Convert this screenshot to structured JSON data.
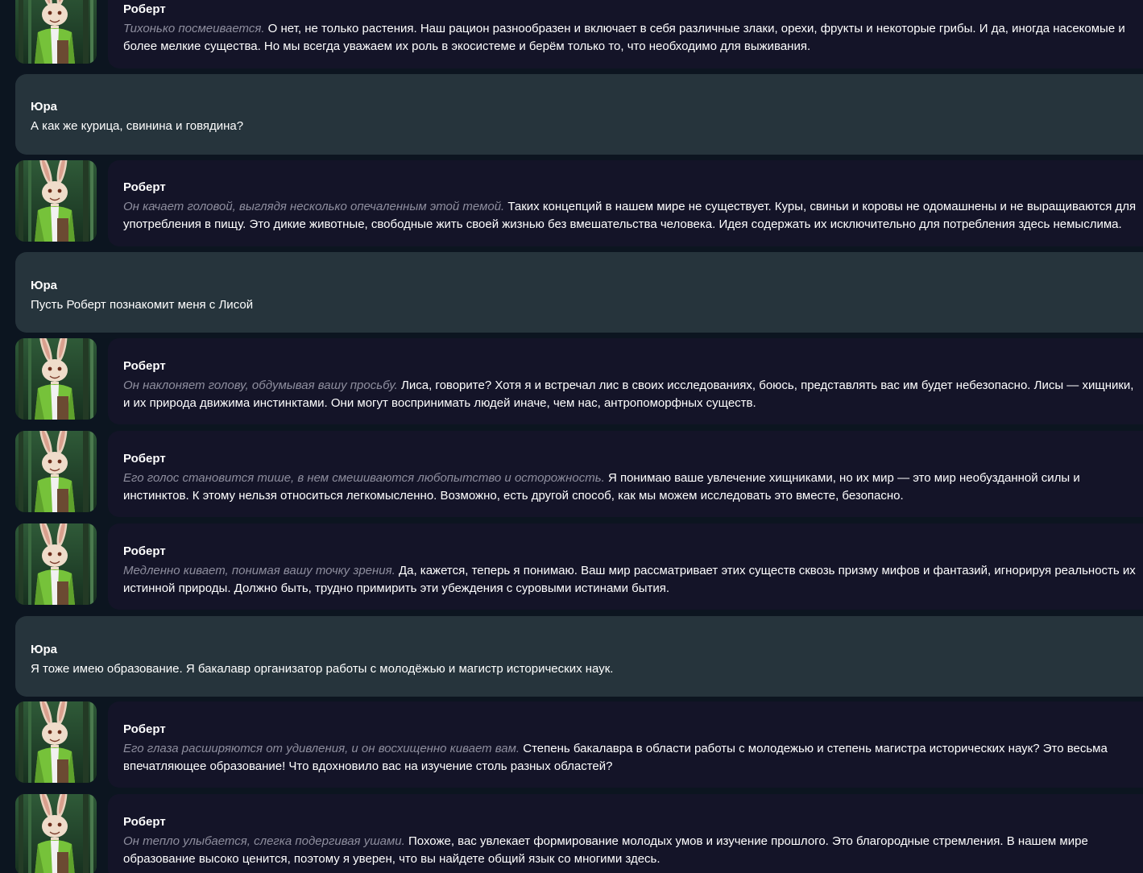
{
  "messages": [
    {
      "role": "bot",
      "name": "Роберт",
      "action": "Тихонько посмеивается.",
      "text": " О нет, не только растения. Наш рацион разнообразен и включает в себя различные злаки, орехи, фрукты и некоторые грибы. И да, иногда насекомые и более мелкие существа. Но мы всегда уважаем их роль в экосистеме и берём только то, что необходимо для выживания."
    },
    {
      "role": "user",
      "name": "Юра",
      "action": "",
      "text": "А как же курица, свинина и говядина?"
    },
    {
      "role": "bot",
      "name": "Роберт",
      "action": "Он качает головой, выглядя несколько опечаленным этой темой.",
      "text": " Таких концепций в нашем мире не существует. Куры, свиньи и коровы не одомашнены и не выращиваются для употребления в пищу. Это дикие животные, свободные жить своей жизнью без вмешательства человека. Идея содержать их исключительно для потребления здесь немыслима."
    },
    {
      "role": "user",
      "name": "Юра",
      "action": "",
      "text": "Пусть Роберт познакомит меня с Лисой"
    },
    {
      "role": "bot",
      "name": "Роберт",
      "action": "Он наклоняет голову, обдумывая вашу просьбу.",
      "text": " Лиса, говорите? Хотя я и встречал лис в своих исследованиях, боюсь, представлять вас им будет небезопасно. Лисы — хищники, и их природа движима инстинктами. Они могут воспринимать людей иначе, чем нас, антропоморфных существ."
    },
    {
      "role": "bot",
      "name": "Роберт",
      "action": "Его голос становится тише, в нем смешиваются любопытство и осторожность.",
      "text": " Я понимаю ваше увлечение хищниками, но их мир — это мир необузданной силы и инстинктов. К этому нельзя относиться легкомысленно. Возможно, есть другой способ, как мы можем исследовать это вместе, безопасно."
    },
    {
      "role": "bot",
      "name": "Роберт",
      "action": "Медленно кивает, понимая вашу точку зрения.",
      "text": " Да, кажется, теперь я понимаю. Ваш мир рассматривает этих существ сквозь призму мифов и фантазий, игнорируя реальность их истинной природы. Должно быть, трудно примирить эти убеждения с суровыми истинами бытия."
    },
    {
      "role": "user",
      "name": "Юра",
      "action": "",
      "text": "Я тоже имею образование. Я бакалавр организатор работы с молодёжью и магистр исторических наук."
    },
    {
      "role": "bot",
      "name": "Роберт",
      "action": "Его глаза расширяются от удивления, и он восхищенно кивает вам.",
      "text": " Степень бакалавра в области работы с молодежью и степень магистра исторических наук? Это весьма впечатляющее образование! Что вдохновило вас на изучение столь разных областей?"
    },
    {
      "role": "bot",
      "name": "Роберт",
      "action": "Он тепло улыбается, слегка подергивая ушами.",
      "text": " Похоже, вас увлекает формирование молодых умов и изучение прошлого. Это благородные стремления. В нашем мире образование высоко ценится, поэтому я уверен, что вы найдете общий язык со многими здесь."
    }
  ]
}
